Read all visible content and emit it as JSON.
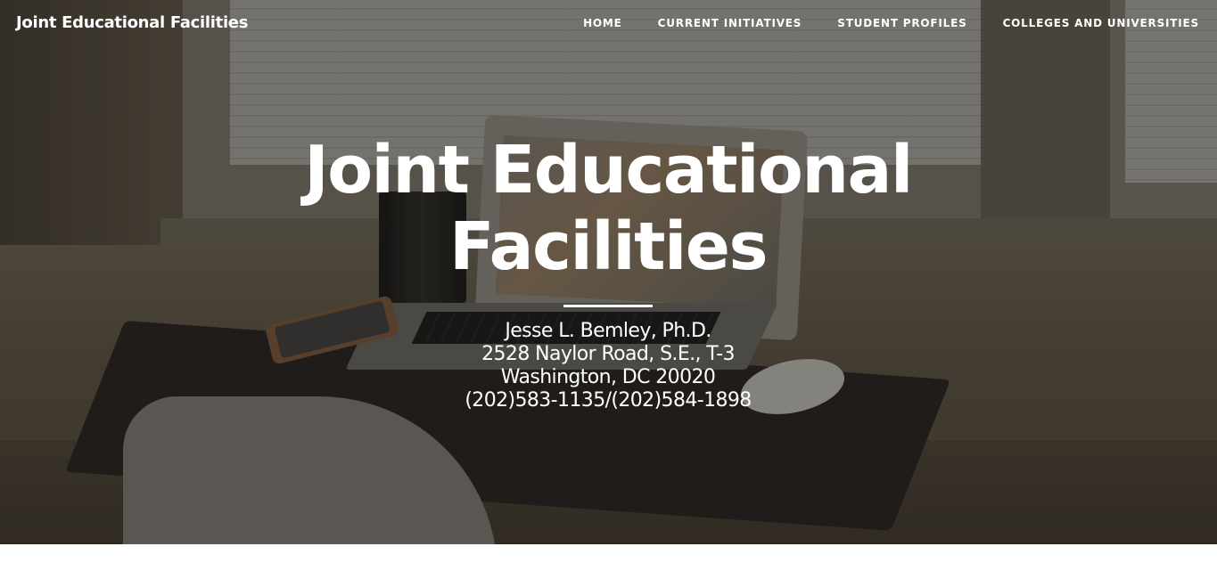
{
  "header": {
    "brand": "Joint Educational Facilities",
    "nav": [
      {
        "label": "HOME"
      },
      {
        "label": "CURRENT INITIATIVES"
      },
      {
        "label": "STUDENT PROFILES"
      },
      {
        "label": "COLLEGES AND UNIVERSITIES"
      }
    ]
  },
  "hero": {
    "title_line1": "Joint Educational",
    "title_line2": "Facilities",
    "contact": {
      "name": "Jesse L. Bemley, Ph.D.",
      "street": "2528 Naylor Road, S.E., T-3",
      "city": "Washington, DC 20020",
      "phone": "(202)583-1135/(202)584-1898"
    }
  },
  "colors": {
    "text": "#ffffff",
    "overlay": "rgba(0,0,0,0.18)",
    "page_background": "#ffffff"
  }
}
